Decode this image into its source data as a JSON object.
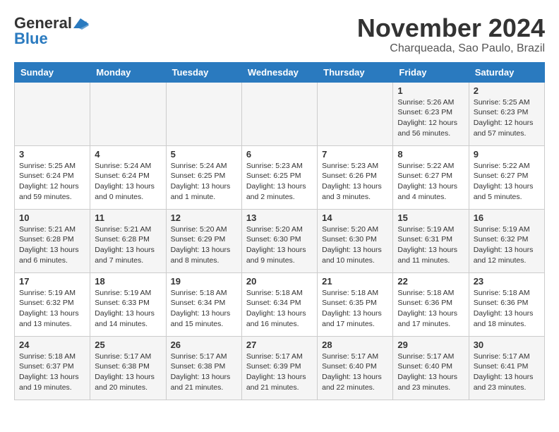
{
  "header": {
    "logo_general": "General",
    "logo_blue": "Blue",
    "month": "November 2024",
    "location": "Charqueada, Sao Paulo, Brazil"
  },
  "weekdays": [
    "Sunday",
    "Monday",
    "Tuesday",
    "Wednesday",
    "Thursday",
    "Friday",
    "Saturday"
  ],
  "weeks": [
    [
      null,
      null,
      null,
      null,
      null,
      {
        "day": "1",
        "sunrise": "Sunrise: 5:26 AM",
        "sunset": "Sunset: 6:23 PM",
        "daylight": "Daylight: 12 hours and 56 minutes."
      },
      {
        "day": "2",
        "sunrise": "Sunrise: 5:25 AM",
        "sunset": "Sunset: 6:23 PM",
        "daylight": "Daylight: 12 hours and 57 minutes."
      }
    ],
    [
      {
        "day": "3",
        "sunrise": "Sunrise: 5:25 AM",
        "sunset": "Sunset: 6:24 PM",
        "daylight": "Daylight: 12 hours and 59 minutes."
      },
      {
        "day": "4",
        "sunrise": "Sunrise: 5:24 AM",
        "sunset": "Sunset: 6:24 PM",
        "daylight": "Daylight: 13 hours and 0 minutes."
      },
      {
        "day": "5",
        "sunrise": "Sunrise: 5:24 AM",
        "sunset": "Sunset: 6:25 PM",
        "daylight": "Daylight: 13 hours and 1 minute."
      },
      {
        "day": "6",
        "sunrise": "Sunrise: 5:23 AM",
        "sunset": "Sunset: 6:25 PM",
        "daylight": "Daylight: 13 hours and 2 minutes."
      },
      {
        "day": "7",
        "sunrise": "Sunrise: 5:23 AM",
        "sunset": "Sunset: 6:26 PM",
        "daylight": "Daylight: 13 hours and 3 minutes."
      },
      {
        "day": "8",
        "sunrise": "Sunrise: 5:22 AM",
        "sunset": "Sunset: 6:27 PM",
        "daylight": "Daylight: 13 hours and 4 minutes."
      },
      {
        "day": "9",
        "sunrise": "Sunrise: 5:22 AM",
        "sunset": "Sunset: 6:27 PM",
        "daylight": "Daylight: 13 hours and 5 minutes."
      }
    ],
    [
      {
        "day": "10",
        "sunrise": "Sunrise: 5:21 AM",
        "sunset": "Sunset: 6:28 PM",
        "daylight": "Daylight: 13 hours and 6 minutes."
      },
      {
        "day": "11",
        "sunrise": "Sunrise: 5:21 AM",
        "sunset": "Sunset: 6:28 PM",
        "daylight": "Daylight: 13 hours and 7 minutes."
      },
      {
        "day": "12",
        "sunrise": "Sunrise: 5:20 AM",
        "sunset": "Sunset: 6:29 PM",
        "daylight": "Daylight: 13 hours and 8 minutes."
      },
      {
        "day": "13",
        "sunrise": "Sunrise: 5:20 AM",
        "sunset": "Sunset: 6:30 PM",
        "daylight": "Daylight: 13 hours and 9 minutes."
      },
      {
        "day": "14",
        "sunrise": "Sunrise: 5:20 AM",
        "sunset": "Sunset: 6:30 PM",
        "daylight": "Daylight: 13 hours and 10 minutes."
      },
      {
        "day": "15",
        "sunrise": "Sunrise: 5:19 AM",
        "sunset": "Sunset: 6:31 PM",
        "daylight": "Daylight: 13 hours and 11 minutes."
      },
      {
        "day": "16",
        "sunrise": "Sunrise: 5:19 AM",
        "sunset": "Sunset: 6:32 PM",
        "daylight": "Daylight: 13 hours and 12 minutes."
      }
    ],
    [
      {
        "day": "17",
        "sunrise": "Sunrise: 5:19 AM",
        "sunset": "Sunset: 6:32 PM",
        "daylight": "Daylight: 13 hours and 13 minutes."
      },
      {
        "day": "18",
        "sunrise": "Sunrise: 5:19 AM",
        "sunset": "Sunset: 6:33 PM",
        "daylight": "Daylight: 13 hours and 14 minutes."
      },
      {
        "day": "19",
        "sunrise": "Sunrise: 5:18 AM",
        "sunset": "Sunset: 6:34 PM",
        "daylight": "Daylight: 13 hours and 15 minutes."
      },
      {
        "day": "20",
        "sunrise": "Sunrise: 5:18 AM",
        "sunset": "Sunset: 6:34 PM",
        "daylight": "Daylight: 13 hours and 16 minutes."
      },
      {
        "day": "21",
        "sunrise": "Sunrise: 5:18 AM",
        "sunset": "Sunset: 6:35 PM",
        "daylight": "Daylight: 13 hours and 17 minutes."
      },
      {
        "day": "22",
        "sunrise": "Sunrise: 5:18 AM",
        "sunset": "Sunset: 6:36 PM",
        "daylight": "Daylight: 13 hours and 17 minutes."
      },
      {
        "day": "23",
        "sunrise": "Sunrise: 5:18 AM",
        "sunset": "Sunset: 6:36 PM",
        "daylight": "Daylight: 13 hours and 18 minutes."
      }
    ],
    [
      {
        "day": "24",
        "sunrise": "Sunrise: 5:18 AM",
        "sunset": "Sunset: 6:37 PM",
        "daylight": "Daylight: 13 hours and 19 minutes."
      },
      {
        "day": "25",
        "sunrise": "Sunrise: 5:17 AM",
        "sunset": "Sunset: 6:38 PM",
        "daylight": "Daylight: 13 hours and 20 minutes."
      },
      {
        "day": "26",
        "sunrise": "Sunrise: 5:17 AM",
        "sunset": "Sunset: 6:38 PM",
        "daylight": "Daylight: 13 hours and 21 minutes."
      },
      {
        "day": "27",
        "sunrise": "Sunrise: 5:17 AM",
        "sunset": "Sunset: 6:39 PM",
        "daylight": "Daylight: 13 hours and 21 minutes."
      },
      {
        "day": "28",
        "sunrise": "Sunrise: 5:17 AM",
        "sunset": "Sunset: 6:40 PM",
        "daylight": "Daylight: 13 hours and 22 minutes."
      },
      {
        "day": "29",
        "sunrise": "Sunrise: 5:17 AM",
        "sunset": "Sunset: 6:40 PM",
        "daylight": "Daylight: 13 hours and 23 minutes."
      },
      {
        "day": "30",
        "sunrise": "Sunrise: 5:17 AM",
        "sunset": "Sunset: 6:41 PM",
        "daylight": "Daylight: 13 hours and 23 minutes."
      }
    ]
  ]
}
